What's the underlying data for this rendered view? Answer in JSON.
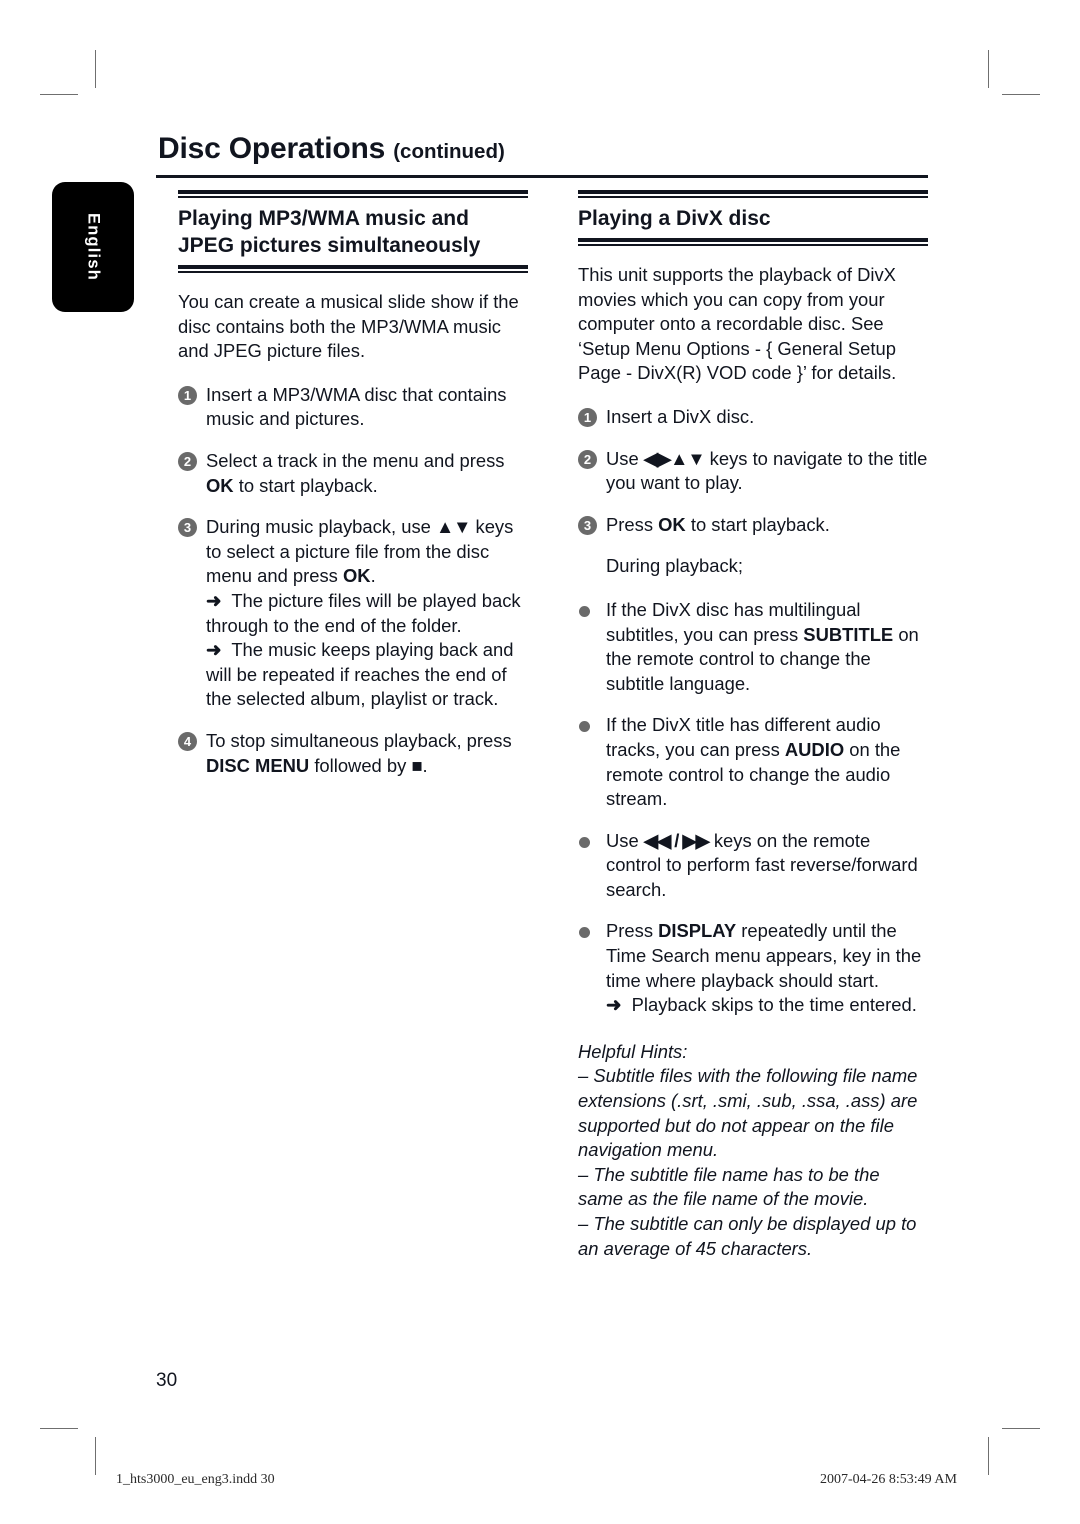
{
  "page": {
    "title_main": "Disc Operations",
    "title_suffix": "(continued)",
    "language_tab": "English",
    "page_number": "30"
  },
  "footer": {
    "file_name": "1_hts3000_eu_eng3.indd   30",
    "timestamp": "2007-04-26   8:53:49 AM"
  },
  "left_column": {
    "heading": "Playing MP3/WMA music and JPEG pictures simultaneously",
    "intro": "You can create a musical slide show if the disc contains both the MP3/WMA music and JPEG picture files.",
    "steps": [
      {
        "number": "1",
        "text": "Insert a MP3/WMA disc that contains music and pictures."
      },
      {
        "number": "2",
        "text_before": "Select a track in the menu and press ",
        "bold": "OK",
        "text_after": " to start playback."
      },
      {
        "number": "3",
        "text_before": "During music playback, use ",
        "keys": "▲▼",
        "text_mid": " keys to select a picture file from the disc menu and press ",
        "bold": "OK",
        "text_after": ".",
        "results": [
          "The picture files will be played back through to the end of the folder.",
          "The music keeps playing back and will be repeated if reaches the end of the selected album, playlist or track."
        ]
      },
      {
        "number": "4",
        "text_before": "To stop simultaneous playback, press ",
        "bold": "DISC MENU",
        "text_after": " followed by ",
        "stop_glyph": "■",
        "text_end": "."
      }
    ]
  },
  "right_column": {
    "heading": "Playing a DivX disc",
    "intro": "This unit supports the playback of DivX movies which you can copy from your computer onto a recordable disc. See ‘Setup Menu Options - { General Setup Page - DivX(R) VOD code }’ for details.",
    "steps": [
      {
        "number": "1",
        "text": "Insert a DivX disc."
      },
      {
        "number": "2",
        "text_before": "Use ",
        "keys": "◀▶▲▼",
        "text_after": " keys to navigate to the title you want to play."
      },
      {
        "number": "3",
        "text_before": "Press ",
        "bold": "OK",
        "text_after": " to start playback."
      }
    ],
    "during_playback_label": "During playback;",
    "bullets": [
      {
        "text_before": "If the DivX disc has multilingual subtitles, you can press ",
        "bold": "SUBTITLE",
        "text_after": " on the remote control to change the subtitle language."
      },
      {
        "text_before": "If the DivX title has different audio tracks, you can press ",
        "bold": "AUDIO",
        "text_after": " on the remote control to change the audio stream."
      },
      {
        "text_before": "Use ",
        "keys": "◀◀ / ▶▶",
        "text_after": " keys on the remote control to perform fast reverse/forward search."
      },
      {
        "text_before": "Press ",
        "bold": "DISPLAY",
        "text_after": " repeatedly until the Time Search menu appears, key in the time where playback should start.",
        "result": "Playback skips to the time entered."
      }
    ],
    "hints": {
      "title": "Helpful Hints:",
      "lines": [
        "– Subtitle files with the following file name extensions (.srt, .smi, .sub, .ssa, .ass) are supported but do not appear on the file navigation menu.",
        "– The subtitle file name has to be the same as the file name of the movie.",
        "– The subtitle can only be displayed up to an average of 45 characters."
      ]
    }
  },
  "colors": {
    "ink": "#11151f",
    "marker_gray": "#6a6a6a",
    "crop_gray": "#6f6f6f"
  }
}
